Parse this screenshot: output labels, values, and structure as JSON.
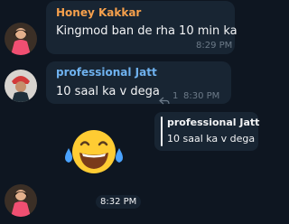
{
  "messages": [
    {
      "sender": "Honey Kakkar",
      "text": "Kingmod ban de rha 10 min ka",
      "time": "8:29 PM"
    },
    {
      "sender": "professional Jatt",
      "text": "10 saal ka v dega",
      "time": "8:30 PM",
      "reply_count": "1"
    }
  ],
  "reply_preview": {
    "sender": "professional Jatt",
    "text": "10 saal ka v dega"
  },
  "sticker": {
    "name": "face-with-tears-of-joy-icon",
    "glyph": "😂"
  },
  "last_time": "8:32 PM",
  "colors": {
    "background": "#0e1621",
    "bubble": "#182533",
    "sender_honey": "#f6a04c",
    "sender_jatt": "#6fb2ef",
    "time": "#6c7a88"
  }
}
